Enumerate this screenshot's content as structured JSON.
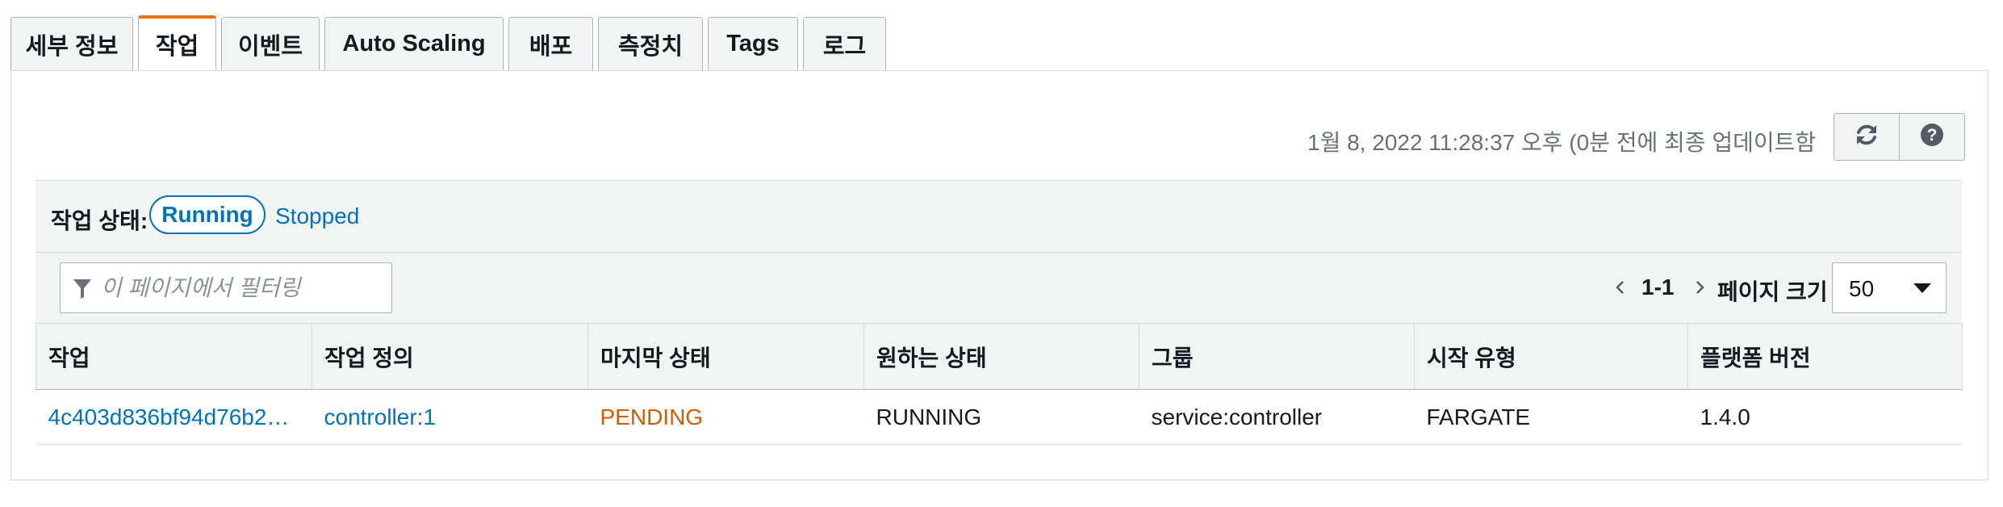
{
  "tabs": [
    {
      "label": "세부 정보",
      "active": false
    },
    {
      "label": "작업",
      "active": true
    },
    {
      "label": "이벤트",
      "active": false
    },
    {
      "label": "Auto Scaling",
      "active": false
    },
    {
      "label": "배포",
      "active": false
    },
    {
      "label": "측정치",
      "active": false
    },
    {
      "label": "Tags",
      "active": false
    },
    {
      "label": "로그",
      "active": false
    }
  ],
  "header": {
    "timestamp": "1월 8, 2022 11:28:37 오후 (0분 전에 최종 업데이트함",
    "refresh_icon": "refresh-icon",
    "help_icon": "help-icon"
  },
  "status_filter": {
    "label": "작업 상태:",
    "running": "Running",
    "stopped": "Stopped"
  },
  "filter": {
    "placeholder": "이 페이지에서 필터링"
  },
  "pagination": {
    "range": "1-1",
    "page_size_label": "페이지 크기",
    "page_size": "50"
  },
  "table": {
    "columns": [
      "작업",
      "작업 정의",
      "마지막 상태",
      "원하는 상태",
      "그룹",
      "시작 유형",
      "플랫폼 버전"
    ],
    "rows": [
      {
        "task": "4c403d836bf94d76b2…",
        "task_definition": "controller:1",
        "last_status": "PENDING",
        "desired_status": "RUNNING",
        "group": "service:controller",
        "launch_type": "FARGATE",
        "platform_version": "1.4.0"
      }
    ]
  },
  "colors": {
    "accent": "#ec7211",
    "link": "#0073bb",
    "pending": "#d45b07",
    "panel_bg": "#f2f3f3"
  }
}
